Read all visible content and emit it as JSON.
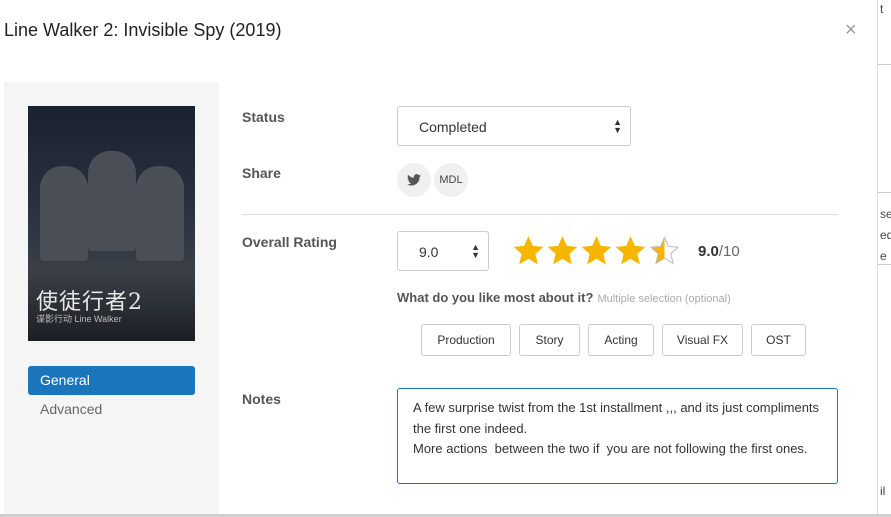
{
  "modal": {
    "title": "Line Walker 2: Invisible Spy (2019)",
    "close_glyph": "×"
  },
  "poster": {
    "cn_title": "使徒行者2",
    "sub_title": "谍影行动   Line Walker"
  },
  "sidebar": {
    "items": [
      {
        "label": "General",
        "active": true
      },
      {
        "label": "Advanced",
        "active": false
      }
    ]
  },
  "status": {
    "label": "Status",
    "value": "Completed"
  },
  "share": {
    "label": "Share",
    "buttons": [
      {
        "icon": "twitter-icon"
      },
      {
        "label": "MDL"
      }
    ]
  },
  "rating": {
    "label": "Overall Rating",
    "select_value": "9.0",
    "stars_filled": 4.5,
    "stars_total": 5,
    "score": "9.0",
    "score_max": "/10",
    "star_color": "#f7b500"
  },
  "likes": {
    "question": "What do you like most about it?",
    "hint": "Multiple selection (optional)",
    "options": [
      "Production",
      "Story",
      "Acting",
      "Visual FX",
      "OST"
    ]
  },
  "notes": {
    "label": "Notes",
    "text": "A few surprise twist from the 1st installment ,,, and its just compliments  the first one indeed.\nMore actions  between the two if  you are not following the first ones."
  },
  "colors": {
    "accent": "#1a75bb"
  }
}
